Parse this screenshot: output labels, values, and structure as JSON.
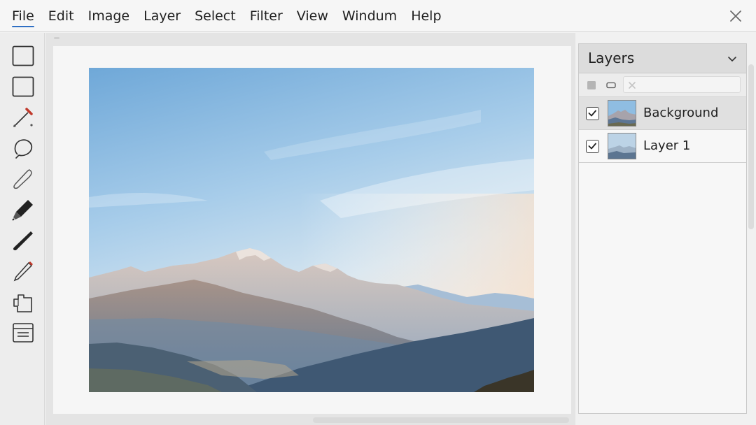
{
  "menu": {
    "items": [
      {
        "label": "File",
        "active": true
      },
      {
        "label": "Edit"
      },
      {
        "label": "Image"
      },
      {
        "label": "Layer"
      },
      {
        "label": "Select"
      },
      {
        "label": "Filter"
      },
      {
        "label": "View"
      },
      {
        "label": "Windum"
      },
      {
        "label": "Help"
      }
    ],
    "close_icon": "close-icon"
  },
  "toolbox": {
    "tools": [
      {
        "name": "rectangle-select-icon"
      },
      {
        "name": "rectangle-shape-icon"
      },
      {
        "name": "eyedropper-icon"
      },
      {
        "name": "lasso-icon"
      },
      {
        "name": "feather-brush-icon"
      },
      {
        "name": "marker-icon"
      },
      {
        "name": "paintbrush-icon"
      },
      {
        "name": "pencil-icon"
      },
      {
        "name": "clone-stamp-icon"
      },
      {
        "name": "layers-tray-icon"
      }
    ]
  },
  "canvas": {
    "image_subject": "mountain-landscape"
  },
  "layers_panel": {
    "title": "Layers",
    "collapse_icon": "chevron-down-icon",
    "toolbar_icons": [
      "fill-square-icon",
      "rounded-rect-icon",
      "clear-filter-icon"
    ],
    "search_placeholder": "",
    "layers": [
      {
        "name": "Background",
        "visible": true,
        "selected": true
      },
      {
        "name": "Layer 1",
        "visible": true,
        "selected": false
      }
    ]
  },
  "colors": {
    "accent": "#2f6fc4",
    "panel_header": "#dcdcdc",
    "selected_row": "#e0e0e0",
    "sky": "#9cc6e6"
  }
}
